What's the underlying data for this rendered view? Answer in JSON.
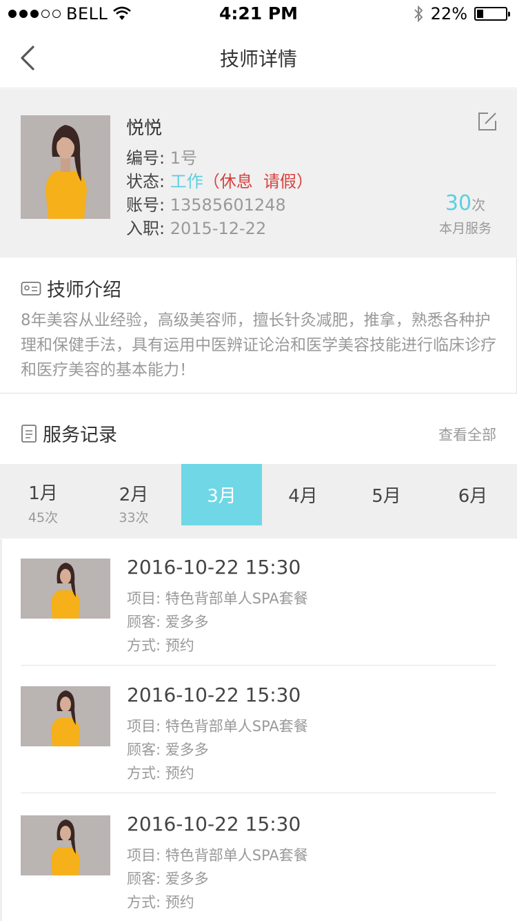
{
  "status_bar": {
    "carrier": "BELL",
    "time": "4:21 PM",
    "battery": "22%",
    "battery_level": 0.22
  },
  "nav": {
    "title": "技师详情"
  },
  "profile": {
    "name": "悦悦",
    "number_label": "编号:",
    "number_value": "1号",
    "status_label": "状态:",
    "status_working": "工作",
    "status_paren_open": "（",
    "status_rest": "休息",
    "status_leave": "请假",
    "status_paren_close": "）",
    "account_label": "账号:",
    "account_value": "13585601248",
    "join_label": "入职:",
    "join_value": "2015-12-22",
    "service_count": "30",
    "service_unit": "次",
    "service_label": "本月服务"
  },
  "intro": {
    "title": "技师介绍",
    "text": "8年美容从业经验，高级美容师，擅长针灸减肥，推拿，熟悉各种护理和保健手法，具有运用中医辨证论治和医学美容技能进行临床诊疗和医疗美容的基本能力！"
  },
  "records_header": {
    "title": "服务记录",
    "view_all": "查看全部"
  },
  "months": [
    {
      "label": "1月",
      "count": "45次"
    },
    {
      "label": "2月",
      "count": "33次"
    },
    {
      "label": "3月",
      "count": ""
    },
    {
      "label": "4月",
      "count": ""
    },
    {
      "label": "5月",
      "count": ""
    },
    {
      "label": "6月",
      "count": ""
    }
  ],
  "records": [
    {
      "datetime": "2016-10-22 15:30",
      "project_label": "项目:",
      "project": "特色背部单人SPA套餐",
      "customer_label": "顾客:",
      "customer": "爱多多",
      "method_label": "方式:",
      "method": "预约"
    },
    {
      "datetime": "2016-10-22 15:30",
      "project_label": "项目:",
      "project": "特色背部单人SPA套餐",
      "customer_label": "顾客:",
      "customer": "爱多多",
      "method_label": "方式:",
      "method": "预约"
    },
    {
      "datetime": "2016-10-22 15:30",
      "project_label": "项目:",
      "project": "特色背部单人SPA套餐",
      "customer_label": "顾客:",
      "customer": "爱多多",
      "method_label": "方式:",
      "method": "预约"
    }
  ],
  "colors": {
    "accent": "#6fd7e6",
    "accent_text": "#5ccfe0",
    "rest_red": "#d9403c",
    "shirt": "#f5b01a"
  }
}
